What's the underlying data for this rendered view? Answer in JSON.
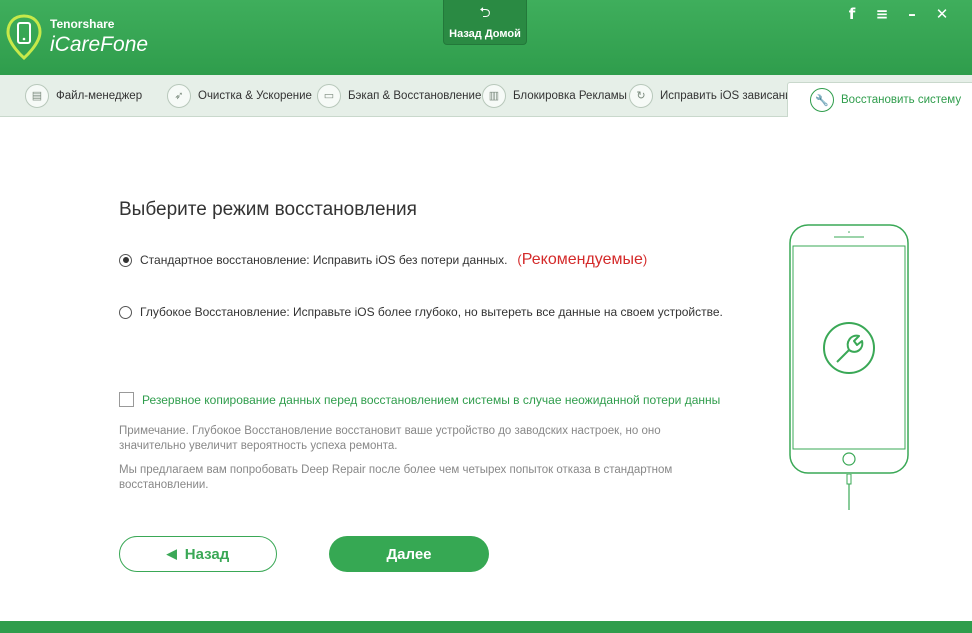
{
  "header": {
    "brand_small": "Tenorshare",
    "brand_big": "iCareFone",
    "home_label": "Назад Домой",
    "icons": [
      "facebook-icon",
      "menu-icon",
      "minimize-icon",
      "close-icon"
    ],
    "ctrl_glyphs": [
      "f",
      "≡",
      "–",
      "✕"
    ]
  },
  "tabs": [
    {
      "label": "Файл-менеджер",
      "icon": "file-icon"
    },
    {
      "label": "Очистка & Ускорение",
      "icon": "rocket-icon"
    },
    {
      "label": "Бэкап & Восстановление",
      "icon": "backup-icon"
    },
    {
      "label": "Блокировка Рекламы",
      "icon": "trash-icon"
    },
    {
      "label": "Исправить iOS зависания",
      "icon": "refresh-icon"
    },
    {
      "label": "Восстановить систему",
      "icon": "wrench-icon",
      "active": true
    }
  ],
  "main": {
    "title": "Выберите режим восстановления",
    "option_standard": "Стандартное восстановление: Исправить iOS без потери данных.",
    "recommended": "Рекомендуемые",
    "recommended_open": "(",
    "recommended_close": ")",
    "option_deep": "Глубокое Восстановление: Исправьте iOS более глубоко, но вытереть все данные на своем устройстве.",
    "backup_checkbox": "Резервное копирование данных перед восстановлением системы в случае неожиданной потери данны",
    "note1": "Примечание. Глубокое Восстановление восстановит ваше устройство до заводских настроек, но оно значительно увеличит вероятность успеха ремонта.",
    "note2": "Мы предлагаем вам попробовать Deep Repair после более чем четырех попыток отказа в стандартном восстановлении.",
    "back_label": "Назад",
    "next_label": "Далее"
  },
  "colors": {
    "brand_green": "#2f9d4c",
    "recommend_red": "#d42a2a"
  }
}
